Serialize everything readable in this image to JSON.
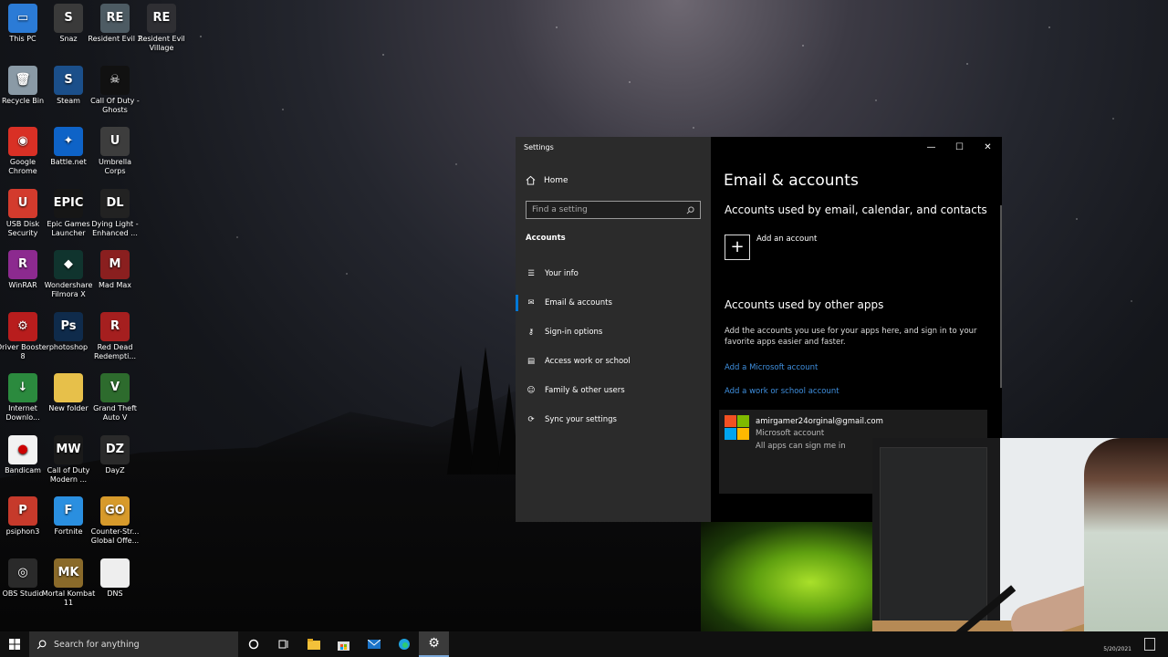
{
  "desktop_icons": [
    {
      "label": "This PC",
      "icon": "computer-icon",
      "color": "#2b7bd6",
      "glyph": "▭"
    },
    {
      "label": "Snaz",
      "icon": "snaz-icon",
      "color": "#3a3a3a",
      "glyph": "S"
    },
    {
      "label": "Resident Evil 2",
      "icon": "game-icon",
      "color": "#4d5b63",
      "glyph": "RE"
    },
    {
      "label": "Resident Evil Village",
      "icon": "game-icon",
      "color": "#2f2f33",
      "glyph": "RE"
    },
    {
      "label": "Recycle Bin",
      "icon": "recycle-bin-icon",
      "color": "#8a9aa6",
      "glyph": "🗑"
    },
    {
      "label": "Steam",
      "icon": "steam-icon",
      "color": "#1b4f8a",
      "glyph": "S"
    },
    {
      "label": "Call Of Duty - Ghosts",
      "icon": "game-icon",
      "color": "#111111",
      "glyph": "☠"
    },
    {
      "label": "Google Chrome",
      "icon": "chrome-icon",
      "color": "#d93025",
      "glyph": "◉"
    },
    {
      "label": "Battle.net",
      "icon": "battlenet-icon",
      "color": "#0e63c7",
      "glyph": "✦"
    },
    {
      "label": "Umbrella Corps",
      "icon": "game-icon",
      "color": "#3d3d3d",
      "glyph": "U"
    },
    {
      "label": "USB Disk Security",
      "icon": "usb-icon",
      "color": "#d33b2d",
      "glyph": "U"
    },
    {
      "label": "Epic Games Launcher",
      "icon": "epic-icon",
      "color": "#161616",
      "glyph": "EPIC"
    },
    {
      "label": "Dying Light - Enhanced ...",
      "icon": "game-icon",
      "color": "#222222",
      "glyph": "DL"
    },
    {
      "label": "WinRAR",
      "icon": "winrar-icon",
      "color": "#8c2a8f",
      "glyph": "R"
    },
    {
      "label": "Wondershare Filmora X",
      "icon": "filmora-icon",
      "color": "#10342e",
      "glyph": "◆"
    },
    {
      "label": "Mad Max",
      "icon": "game-icon",
      "color": "#8a1f1f",
      "glyph": "M"
    },
    {
      "label": "Driver Booster 8",
      "icon": "driver-booster-icon",
      "color": "#b81d1d",
      "glyph": "⚙"
    },
    {
      "label": "photoshop",
      "icon": "photoshop-icon",
      "color": "#0f2b4b",
      "glyph": "Ps"
    },
    {
      "label": "Red Dead Redempti...",
      "icon": "game-icon",
      "color": "#a51f1f",
      "glyph": "R"
    },
    {
      "label": "Internet Downlo...",
      "icon": "idm-icon",
      "color": "#2b8a3e",
      "glyph": "↓"
    },
    {
      "label": "New folder",
      "icon": "folder-icon",
      "color": "#e7c04a",
      "glyph": ""
    },
    {
      "label": "Grand Theft Auto V",
      "icon": "game-icon",
      "color": "#2d6b2d",
      "glyph": "V"
    },
    {
      "label": "Bandicam",
      "icon": "bandicam-icon",
      "color": "#f2f2f2",
      "glyph": "●"
    },
    {
      "label": "Call of Duty Modern ...",
      "icon": "game-icon",
      "color": "#1a1a1a",
      "glyph": "MW"
    },
    {
      "label": "DayZ",
      "icon": "game-icon",
      "color": "#2a2a2a",
      "glyph": "DZ"
    },
    {
      "label": "psiphon3",
      "icon": "psiphon-icon",
      "color": "#c63a2b",
      "glyph": "P"
    },
    {
      "label": "Fortnite",
      "icon": "fortnite-icon",
      "color": "#2a8fe0",
      "glyph": "F"
    },
    {
      "label": "Counter-Str... Global Offe...",
      "icon": "game-icon",
      "color": "#d79a2b",
      "glyph": "GO"
    },
    {
      "label": "OBS Studio",
      "icon": "obs-icon",
      "color": "#2a2a2a",
      "glyph": "◎"
    },
    {
      "label": "Mortal Kombat 11",
      "icon": "game-icon",
      "color": "#8a6a2a",
      "glyph": "MK"
    },
    {
      "label": "DNS",
      "icon": "file-icon",
      "color": "#eeeeee",
      "glyph": ""
    }
  ],
  "settings": {
    "window_title": "Settings",
    "home_label": "Home",
    "search_placeholder": "Find a setting",
    "section_label": "Accounts",
    "nav": [
      {
        "label": "Your info",
        "icon": "person-card-icon",
        "glyph": "☰"
      },
      {
        "label": "Email & accounts",
        "icon": "mail-icon",
        "glyph": "✉"
      },
      {
        "label": "Sign-in options",
        "icon": "key-icon",
        "glyph": "⚷"
      },
      {
        "label": "Access work or school",
        "icon": "briefcase-icon",
        "glyph": "▤"
      },
      {
        "label": "Family & other users",
        "icon": "person-icon",
        "glyph": "☺"
      },
      {
        "label": "Sync your settings",
        "icon": "sync-icon",
        "glyph": "⟳"
      }
    ],
    "page_title": "Email & accounts",
    "section1_title": "Accounts used by email, calendar, and contacts",
    "add_account_label": "Add an account",
    "section2_title": "Accounts used by other apps",
    "section2_desc": "Add the accounts you use for your apps here, and sign in to your favorite apps easier and faster.",
    "link_microsoft": "Add a Microsoft account",
    "link_work": "Add a work or school account",
    "account": {
      "email": "amirgamer24orginal@gmail.com",
      "type": "Microsoft account",
      "apps": "All apps can sign me in"
    },
    "ms_logo_colors": [
      "#f25022",
      "#7fba00",
      "#00a4ef",
      "#ffb900"
    ],
    "accent": "#0078d7",
    "link_color": "#3f8fde"
  },
  "taskbar": {
    "search_placeholder": "Search for anything",
    "date": "5/20/2021"
  }
}
